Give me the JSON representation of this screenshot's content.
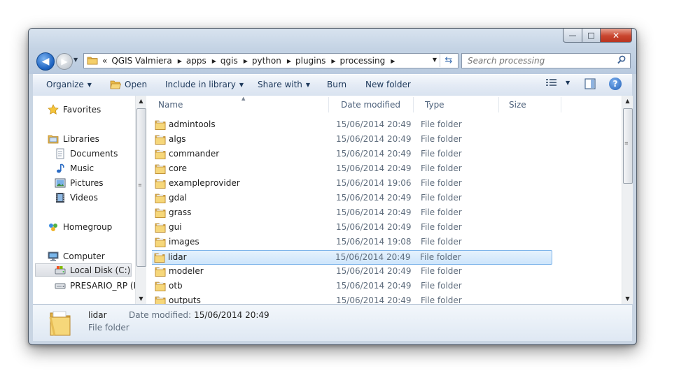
{
  "window": {
    "controls": {
      "minimize": "—",
      "maximize": "□",
      "close": "✕"
    }
  },
  "address": {
    "overflow": "«",
    "crumbs": [
      "QGIS Valmiera",
      "apps",
      "qgis",
      "python",
      "plugins",
      "processing"
    ]
  },
  "search": {
    "placeholder": "Search processing"
  },
  "toolbar": {
    "organize": "Organize",
    "open": "Open",
    "include_in_library": "Include in library",
    "share_with": "Share with",
    "burn": "Burn",
    "new_folder": "New folder",
    "help": "?"
  },
  "nav": {
    "favorites": "Favorites",
    "libraries": "Libraries",
    "documents": "Documents",
    "music": "Music",
    "pictures": "Pictures",
    "videos": "Videos",
    "homegroup": "Homegroup",
    "computer": "Computer",
    "local_disk": "Local Disk (C:)",
    "presario": "PRESARIO_RP (D:"
  },
  "columns": {
    "name": "Name",
    "date_modified": "Date modified",
    "type": "Type",
    "size": "Size"
  },
  "files": [
    {
      "name": "admintools",
      "date": "15/06/2014 20:49",
      "type": "File folder"
    },
    {
      "name": "algs",
      "date": "15/06/2014 20:49",
      "type": "File folder"
    },
    {
      "name": "commander",
      "date": "15/06/2014 20:49",
      "type": "File folder"
    },
    {
      "name": "core",
      "date": "15/06/2014 20:49",
      "type": "File folder"
    },
    {
      "name": "exampleprovider",
      "date": "15/06/2014 19:06",
      "type": "File folder"
    },
    {
      "name": "gdal",
      "date": "15/06/2014 20:49",
      "type": "File folder"
    },
    {
      "name": "grass",
      "date": "15/06/2014 20:49",
      "type": "File folder"
    },
    {
      "name": "gui",
      "date": "15/06/2014 20:49",
      "type": "File folder"
    },
    {
      "name": "images",
      "date": "15/06/2014 19:08",
      "type": "File folder"
    },
    {
      "name": "lidar",
      "date": "15/06/2014 20:49",
      "type": "File folder"
    },
    {
      "name": "modeler",
      "date": "15/06/2014 20:49",
      "type": "File folder"
    },
    {
      "name": "otb",
      "date": "15/06/2014 20:49",
      "type": "File folder"
    },
    {
      "name": "outputs",
      "date": "15/06/2014 20:49",
      "type": "File folder"
    }
  ],
  "selected_index": 9,
  "details": {
    "name": "lidar",
    "type": "File folder",
    "date_label": "Date modified:",
    "date_value": "15/06/2014 20:49"
  },
  "colors": {
    "accent": "#1f64c2",
    "selection": "#cde5fb",
    "folder": "#e8b948"
  }
}
